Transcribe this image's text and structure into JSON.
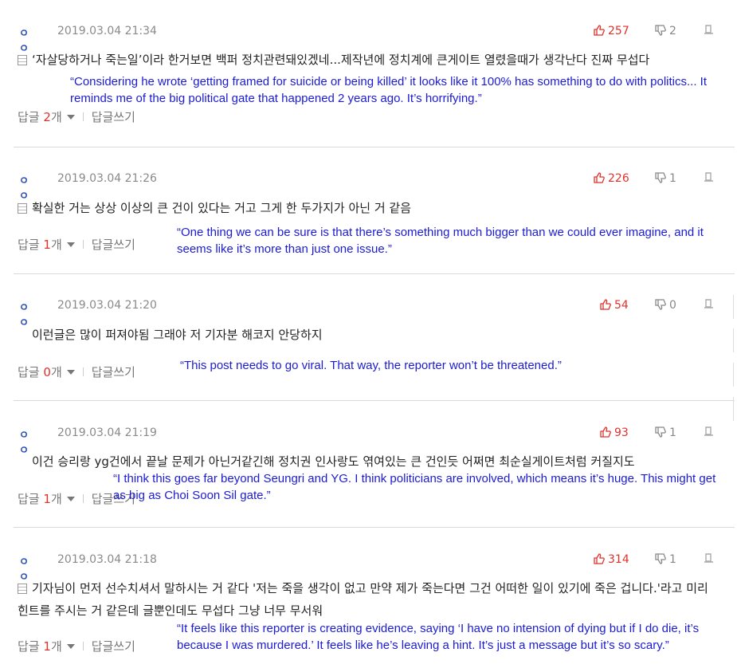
{
  "labels": {
    "reply": "답글",
    "reply_unit": "개",
    "write_reply": "답글쓰기"
  },
  "comments": [
    {
      "nick": "ㅇㅇ",
      "date": "2019.03.04 21:34",
      "up": "257",
      "down": "2",
      "text": "‘자살당하거나 죽는일’이라 한거보면 백퍼 정치관련돼있겠네...제작년에 정치계에 큰게이트 열렸을때가 생각난다 진짜 무섭다",
      "translation": "“Considering he wrote ‘getting framed for suicide or being killed’ it looks like it 100% has something to do with politics... It reminds me of the big political gate that happened 2 years ago. It’s horrifying.”",
      "reply_count": "2"
    },
    {
      "nick": "ㅇㅇ",
      "date": "2019.03.04 21:26",
      "up": "226",
      "down": "1",
      "text": "확실한 거는 상상 이상의 큰 건이 있다는 거고 그게 한 두가지가 아닌 거 같음",
      "translation": "“One thing we can be sure is that there’s something much bigger than we could ever imagine, and it seems like it’s more than just one issue.”",
      "reply_count": "1"
    },
    {
      "nick": "ㅇㅇ",
      "date": "2019.03.04 21:20",
      "up": "54",
      "down": "0",
      "text": "이런글은 많이 퍼져야됨 그래야 저 기자분 해코지 안당하지",
      "translation": "“This post needs to go viral. That way, the reporter won’t be threatened.”",
      "reply_count": "0"
    },
    {
      "nick": "ㅇㅇ",
      "date": "2019.03.04 21:19",
      "up": "93",
      "down": "1",
      "text": "이건 승리랑 yg건에서 끝날 문제가 아닌거같긴해 정치권 인사랑도 엮여있는 큰 건인듯 어쩌면 최순실게이트처럼 커질지도",
      "translation": "“I think this goes far beyond Seungri and YG. I think politicians are involved, which means it’s huge. This might get as big as Choi Soon Sil gate.”",
      "reply_count": "1"
    },
    {
      "nick": "ㅇㅇ",
      "date": "2019.03.04 21:18",
      "up": "314",
      "down": "1",
      "text": "기자님이 먼저 선수치셔서 말하시는 거 같다 '저는 죽을 생각이 없고 만약 제가 죽는다면 그건 어떠한 일이 있기에 죽은 겁니다.'라고 미리 힌트를 주시는 거 같은데 글뿐인데도 무섭다 그냥 너무 무서워",
      "translation": "“It feels like this reporter is creating evidence, saying ‘I have no intension of dying but if I do die, it’s because I was murdered.’ It feels like he’s leaving a hint. It’s just a message but it’s so scary.”",
      "reply_count": "1"
    }
  ],
  "colors": {
    "upvote": "#e0312b",
    "translation": "#1b1bd6",
    "nick": "#2a4fb5"
  }
}
